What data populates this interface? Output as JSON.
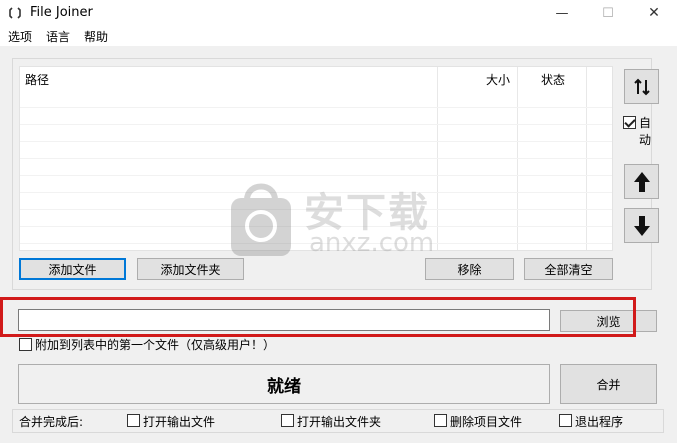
{
  "window": {
    "title": "File Joiner",
    "minimize_glyph": "—",
    "maximize_glyph": "☐",
    "close_glyph": "✕"
  },
  "menu": [
    "选项",
    "语言",
    "帮助"
  ],
  "list": {
    "columns": {
      "path": "路径",
      "size": "大小",
      "status": "状态"
    },
    "rows": []
  },
  "side": {
    "auto_label": "自动",
    "auto_checked": true
  },
  "buttons": {
    "add_file": "添加文件",
    "add_folder": "添加文件夹",
    "remove": "移除",
    "clear_all": "全部清空",
    "browse": "浏览",
    "merge": "合并"
  },
  "output": {
    "value": "",
    "append_first_label": "附加到列表中的第一个文件（仅高级用户！）"
  },
  "status": {
    "text": "就绪"
  },
  "after_merge": {
    "label": "合并完成后:",
    "options": [
      "打开输出文件",
      "打开输出文件夹",
      "删除项目文件",
      "退出程序"
    ]
  },
  "watermark": {
    "cn": "安下载",
    "en": "anxz.com"
  },
  "colors": {
    "highlight": "#d11a1a",
    "focus": "#0078d7"
  },
  "icons": {
    "sort": "sort-arrows-icon",
    "up": "arrow-up-icon",
    "down": "arrow-down-icon",
    "app": "app-icon"
  }
}
